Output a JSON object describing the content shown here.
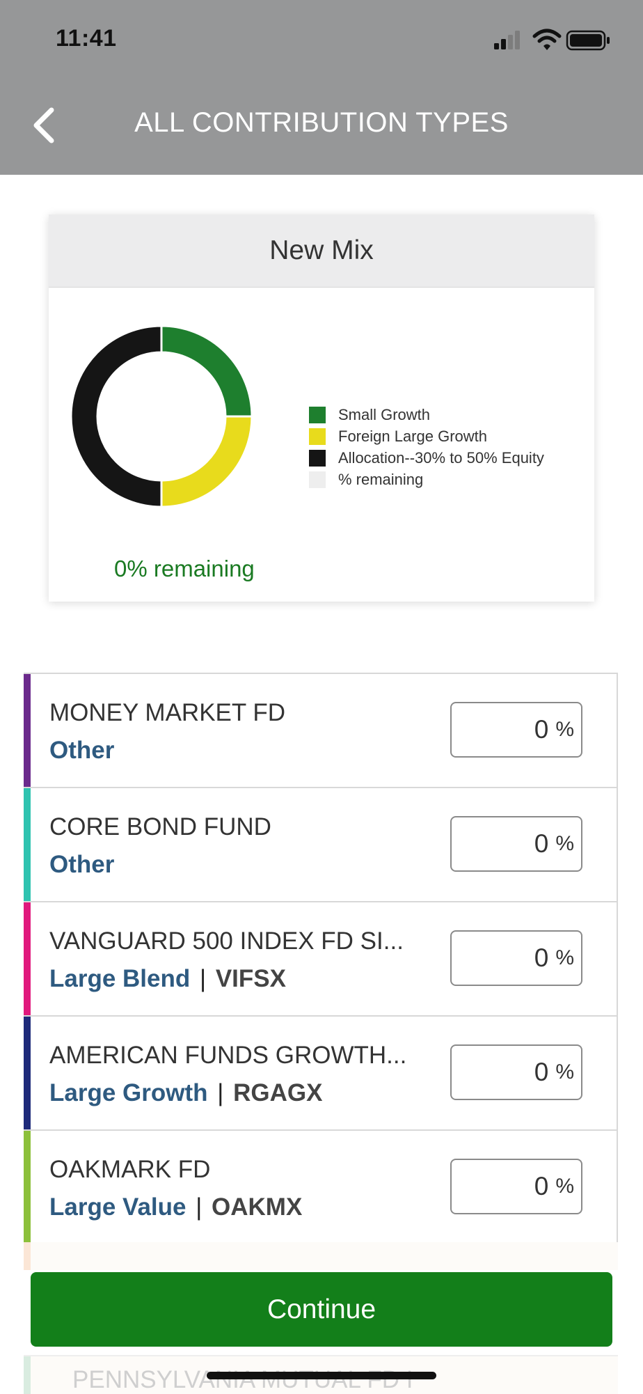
{
  "status_bar": {
    "time": "11:41"
  },
  "header": {
    "title": "ALL CONTRIBUTION TYPES",
    "back_icon": "chevron-left-icon"
  },
  "mix": {
    "title": "New Mix",
    "remaining_text": "0% remaining",
    "chart_data": {
      "type": "pie",
      "categories": [
        "Small Growth",
        "Foreign Large Growth",
        "Allocation--30% to 50% Equity",
        "% remaining"
      ],
      "values": [
        25,
        25,
        50,
        0
      ],
      "colors": [
        "#1e7f2e",
        "#e8db1c",
        "#151515",
        "#eeeeee"
      ]
    },
    "legend": [
      {
        "label": "Small Growth",
        "color": "#1e7f2e"
      },
      {
        "label": "Foreign Large Growth",
        "color": "#e8db1c"
      },
      {
        "label": "Allocation--30% to 50% Equity",
        "color": "#151515"
      },
      {
        "label": "% remaining",
        "color": "#eeeeee"
      }
    ]
  },
  "funds": [
    {
      "name": "MONEY MARKET FD",
      "category": "Other",
      "ticker": "",
      "value": "0",
      "unit": "%",
      "accent": "#6b2a8c"
    },
    {
      "name": "CORE BOND FUND",
      "category": "Other",
      "ticker": "",
      "value": "0",
      "unit": "%",
      "accent": "#2fc3b0"
    },
    {
      "name": "VANGUARD 500 INDEX FD SI...",
      "category": "Large Blend",
      "ticker": "VIFSX",
      "value": "0",
      "unit": "%",
      "accent": "#e0197d"
    },
    {
      "name": "AMERICAN FUNDS GROWTH...",
      "category": "Large Growth",
      "ticker": "RGAGX",
      "value": "0",
      "unit": "%",
      "accent": "#1e2a7a"
    },
    {
      "name": "OAKMARK FD",
      "category": "Large Value",
      "ticker": "OAKMX",
      "value": "0",
      "unit": "%",
      "accent": "#8cc03a"
    }
  ],
  "faded": {
    "bottom_row_name": "PENNSYLVANIA MUTUAL FD I"
  },
  "actions": {
    "continue_label": "Continue"
  }
}
